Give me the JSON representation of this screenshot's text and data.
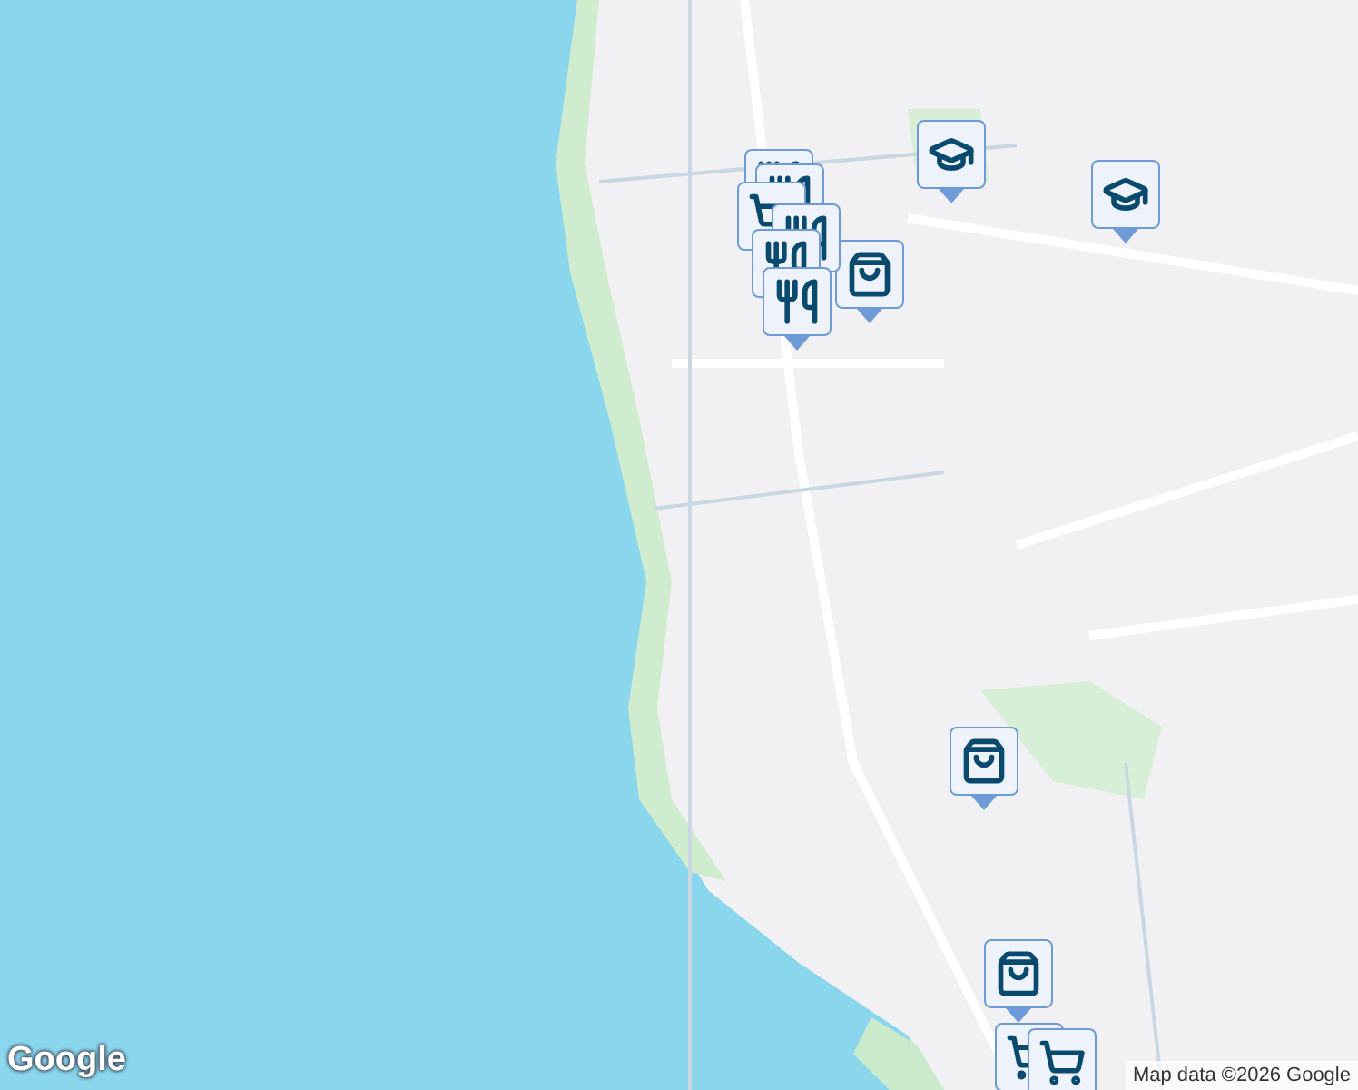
{
  "markers": [
    {
      "kind": "dining"
    },
    {
      "kind": "dining"
    },
    {
      "kind": "cart"
    },
    {
      "kind": "dining"
    },
    {
      "kind": "dining"
    },
    {
      "kind": "dining"
    },
    {
      "kind": "shopping"
    },
    {
      "kind": "school"
    },
    {
      "kind": "school"
    },
    {
      "kind": "shopping"
    },
    {
      "kind": "shopping"
    },
    {
      "kind": "cart"
    },
    {
      "kind": "cart"
    }
  ],
  "logo": "Google",
  "attribution": "Map data ©2026 Google"
}
